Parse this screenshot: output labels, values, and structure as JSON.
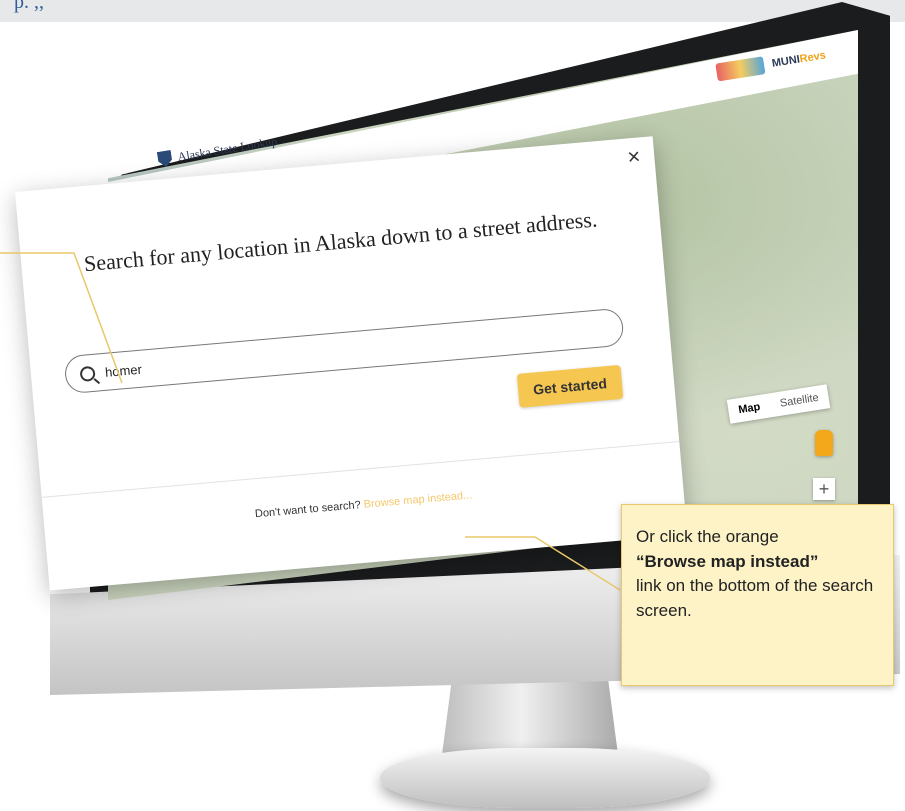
{
  "page": {
    "top_fragment": "p. ,,"
  },
  "app": {
    "title": "Alaska State Lookup",
    "muni_logo_prefix": "MUNI",
    "muni_logo_suffix": "Revs"
  },
  "map": {
    "type_map": "Map",
    "type_satellite": "Satellite",
    "zoom_in": "+"
  },
  "modal": {
    "close": "×",
    "heading": "Search for any location in Alaska down to a street address.",
    "search_value": "homer",
    "get_started": "Get started",
    "footer_prompt": "Don't want to search?",
    "footer_link": "Browse map instead..."
  },
  "callout": {
    "line1": "Or click the orange",
    "emphasis": "“Browse map instead”",
    "line3": "link on the bottom of the search screen."
  },
  "colors": {
    "accent_orange": "#f5c751",
    "callout_bg": "#fdf3c7",
    "callout_border": "#e8c86a"
  }
}
